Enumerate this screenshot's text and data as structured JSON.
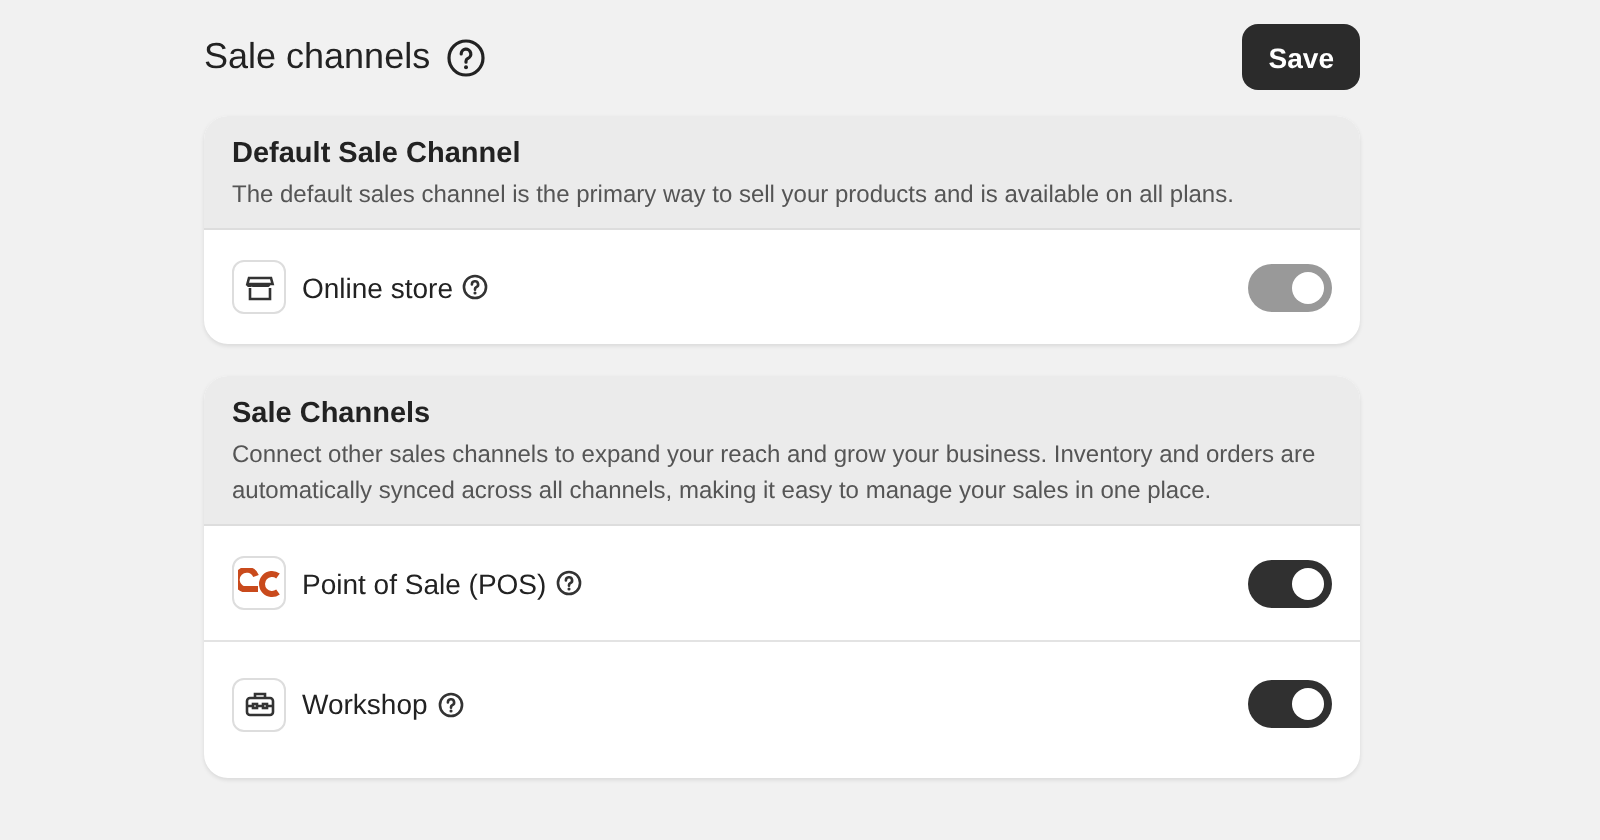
{
  "page": {
    "title": "Sale channels",
    "save_button": "Save"
  },
  "sections": [
    {
      "title": "Default Sale Channel",
      "description": "The default sales channel is the primary way to sell your products and is available on all plans.",
      "channels": [
        {
          "name": "Online store",
          "kind": "store",
          "on": true,
          "disabled": true
        }
      ]
    },
    {
      "title": "Sale Channels",
      "description": "Connect other sales channels to expand your reach and grow your business. Inventory and orders are automatically synced across all channels, making it easy to manage your sales in one place.",
      "channels": [
        {
          "name": "Point of Sale (POS)",
          "kind": "pos",
          "on": true,
          "disabled": false
        },
        {
          "name": "Workshop",
          "kind": "workshop",
          "on": true,
          "disabled": false
        }
      ]
    }
  ]
}
